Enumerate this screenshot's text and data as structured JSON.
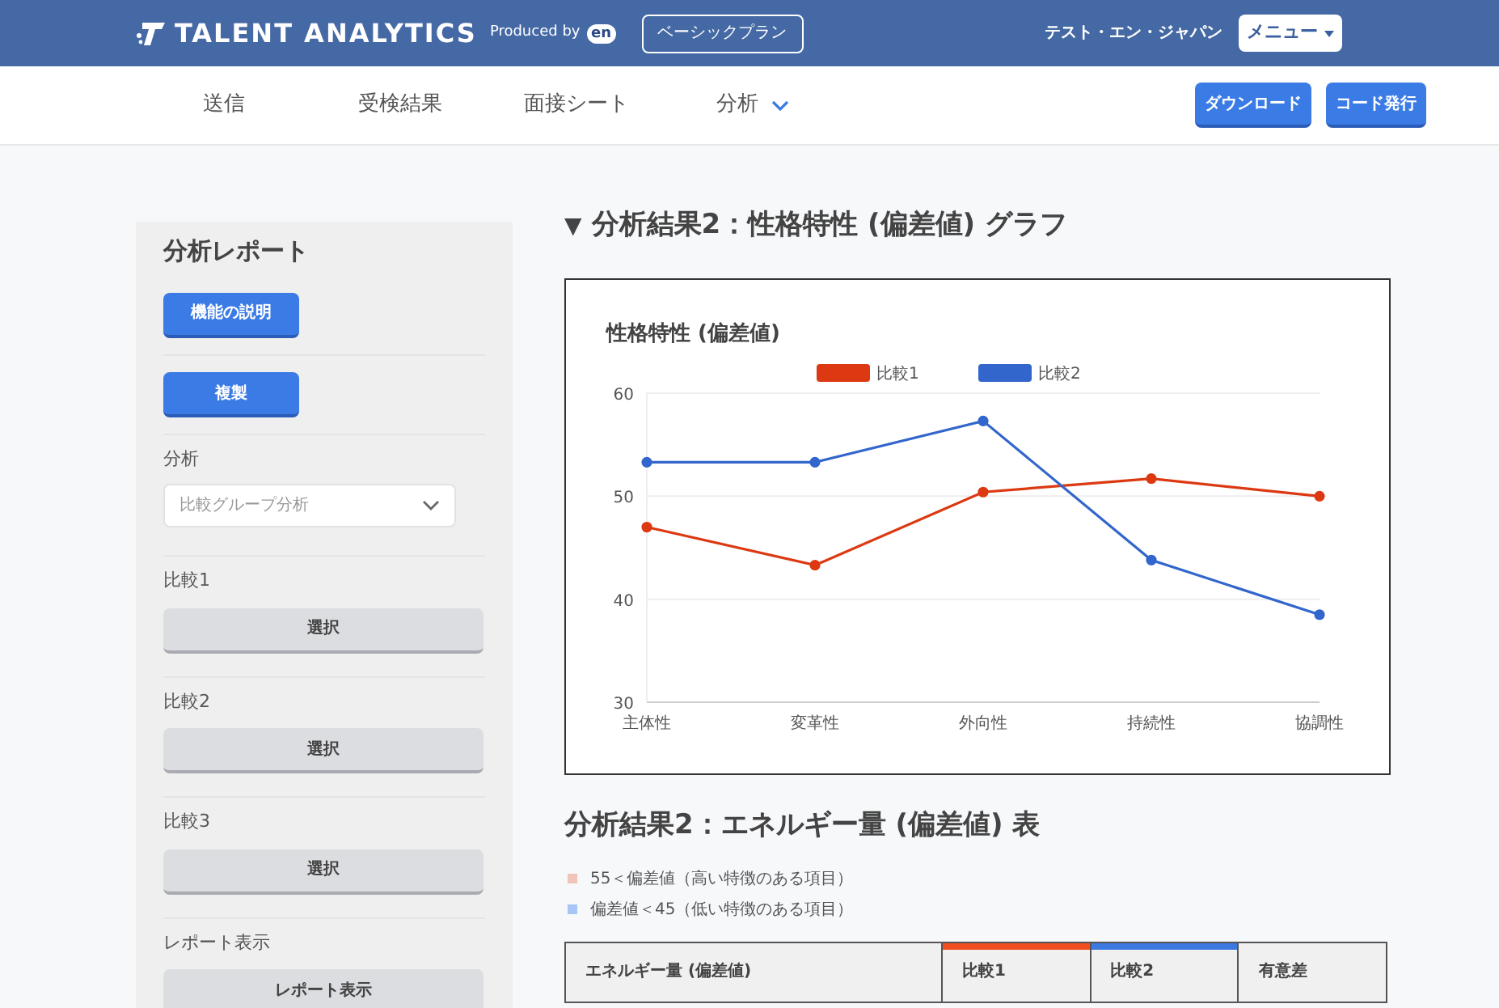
{
  "header": {
    "logo": "TALENT ANALYTICS",
    "produced_by": "Produced by",
    "brand": "en",
    "plan": "ベーシックプラン",
    "user": "テスト・エン・ジャパン",
    "menu": "メニュー"
  },
  "nav": {
    "items": [
      {
        "label": "送信",
        "kind": "link"
      },
      {
        "label": "受検結果",
        "kind": "link"
      },
      {
        "label": "面接シート",
        "kind": "link"
      },
      {
        "label": "分析",
        "kind": "dropdown"
      }
    ],
    "actions": [
      "ダウンロード",
      "コード発行"
    ]
  },
  "sidebar": {
    "title": "分析レポート",
    "sections": [
      {
        "kind": "primary",
        "button": "機能の説明"
      },
      {
        "kind": "primary",
        "button": "複製"
      },
      {
        "kind": "select",
        "label": "分析",
        "value": "比較グループ分析"
      },
      {
        "kind": "choose",
        "label": "比較1",
        "button": "選択"
      },
      {
        "kind": "choose",
        "label": "比較2",
        "button": "選択"
      },
      {
        "kind": "choose",
        "label": "比較3",
        "button": "選択"
      },
      {
        "kind": "choose",
        "label": "レポート表示",
        "button": "レポート表示"
      }
    ]
  },
  "graph_section": {
    "toggle": "▼",
    "heading": "分析結果2：性格特性 (偏差値) グラフ",
    "chart_data": {
      "type": "line",
      "title": "性格特性 (偏差値)",
      "legend": true,
      "categories": [
        "主体性",
        "変革性",
        "外向性",
        "持続性",
        "協調性"
      ],
      "ylim": [
        30,
        60
      ],
      "yticks": [
        30,
        40,
        50,
        60
      ],
      "series": [
        {
          "name": "比較1",
          "color": "#dc3912",
          "marker": "circle",
          "values": [
            47,
            43.3,
            50.4,
            51.7,
            50
          ]
        },
        {
          "name": "比較2",
          "color": "#3366cc",
          "marker": "circle",
          "values": [
            53.3,
            53.3,
            57.3,
            43.8,
            38.5
          ]
        }
      ]
    }
  },
  "table_section": {
    "heading": "分析結果2：エネルギー量 (偏差値) 表",
    "legend": [
      {
        "label": "55＜偏差値（高い特徴のある項目）",
        "color": "#f0c4b8"
      },
      {
        "label": "偏差値＜45（低い特徴のある項目）",
        "color": "#a7c5f5"
      }
    ],
    "columns": [
      {
        "label": "エネルギー量 (偏差値)"
      },
      {
        "label": "比較1",
        "color": "#f04e1e"
      },
      {
        "label": "比較2",
        "color": "#3b78e0"
      },
      {
        "label": "有意差"
      }
    ]
  }
}
